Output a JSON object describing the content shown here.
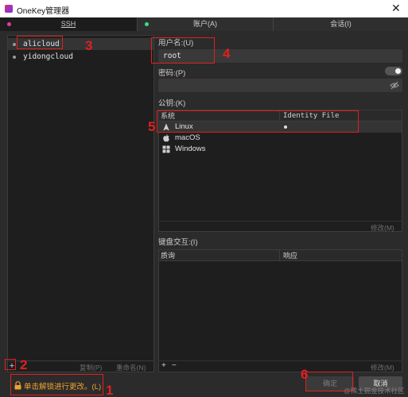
{
  "window": {
    "title": "OneKey管理器",
    "close_glyph": "✕"
  },
  "tabs": [
    {
      "label": "SSH",
      "mnemonic": "S",
      "active": true
    },
    {
      "label": "账户(A)",
      "active": false
    },
    {
      "label": "会话(I)",
      "active": false
    }
  ],
  "hosts": {
    "items": [
      {
        "label": "alicloud",
        "selected": true
      },
      {
        "label": "yidongcloud",
        "selected": false
      }
    ],
    "add_label": "+",
    "copy_label": "复制(P)",
    "rename_label": "重命名(N)"
  },
  "form": {
    "username_label": "用户名:(U)",
    "username_value": "root",
    "password_label": "密码:(P)",
    "password_value": "",
    "key_label": "公钥:(K)",
    "key_table": {
      "headers": [
        "系统",
        "Identity File"
      ],
      "rows": [
        {
          "system": "Linux",
          "icon": "linux-icon",
          "identity": "●"
        },
        {
          "system": "macOS",
          "icon": "apple-icon",
          "identity": ""
        },
        {
          "system": "Windows",
          "icon": "windows-icon",
          "identity": ""
        }
      ],
      "edit_label": "修改(M)"
    },
    "kbd_label": "键盘交互:(I)",
    "kbd_table": {
      "headers": [
        "质询",
        "响应"
      ],
      "add_label": "+",
      "remove_label": "−",
      "edit_label": "修改(M)"
    }
  },
  "footer": {
    "unlock_text": "单击解锁进行更改。(L)",
    "confirm_label": "确定",
    "cancel_label": "取消",
    "watermark": "@稀土掘金技术社区"
  },
  "annotations": [
    "1",
    "2",
    "3",
    "4",
    "5",
    "6"
  ],
  "colors": {
    "accent_red": "#e02020",
    "warning_orange": "#f0a030",
    "ssh_dot": "#e5399d",
    "accounts_dot": "#3ddc84",
    "background": "#2b2b2b"
  }
}
